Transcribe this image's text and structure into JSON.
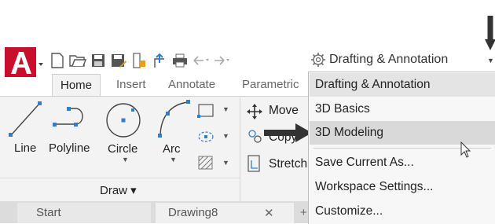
{
  "quick_access": {
    "icons": [
      "new-icon",
      "open-icon",
      "save-icon",
      "save-as-icon",
      "plot-icon",
      "share-icon",
      "print-icon",
      "undo-icon",
      "redo-icon"
    ]
  },
  "ribbon_tabs": [
    "Home",
    "Insert",
    "Annotate",
    "Parametric"
  ],
  "draw_panel": {
    "tools": [
      "Line",
      "Polyline",
      "Circle",
      "Arc"
    ],
    "footer": "Draw ▾"
  },
  "modify_panel": {
    "items": [
      "Move",
      "Copy",
      "Stretch"
    ]
  },
  "file_tabs": {
    "start": "Start",
    "drawing": "Drawing8",
    "close_glyph": "✕",
    "add_glyph": "+"
  },
  "workspace": {
    "current": "Drafting & Annotation",
    "menu": [
      "Drafting & Annotation",
      "3D Basics",
      "3D Modeling"
    ],
    "actions": [
      "Save Current As...",
      "Workspace Settings...",
      "Customize..."
    ]
  },
  "colors": {
    "brand_red": "#c8102e",
    "ribbon_bg": "#f3f3f3",
    "menu_bg": "#f7f7f7",
    "highlight": "#d9d9d9",
    "icon_blue": "#2f7fd0"
  }
}
